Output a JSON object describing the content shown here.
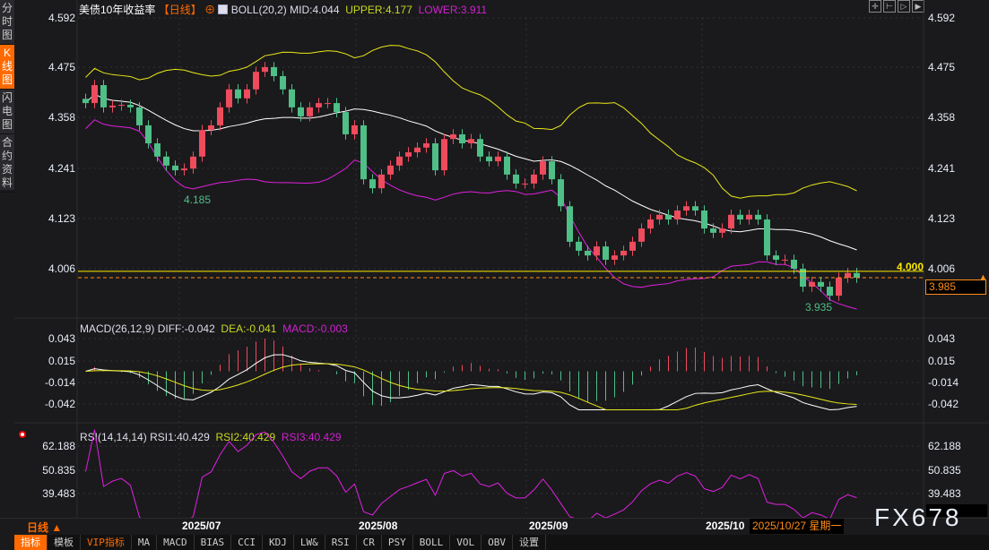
{
  "sidebar": {
    "items": [
      {
        "label": "分时图",
        "active": false
      },
      {
        "label": "K线图",
        "active": true
      },
      {
        "label": "闪电图",
        "active": false
      },
      {
        "label": "合约资料",
        "active": false
      }
    ]
  },
  "header": {
    "title": "美债10年收益率",
    "period": "【日线】",
    "boll": "BOLL(20,2)",
    "mid": "MID:4.044",
    "upper": "UPPER:4.177",
    "lower": "LOWER:3.911"
  },
  "toolbar": {
    "icons": [
      "crosshair-icon",
      "zoom-in-icon",
      "zoom-out-icon",
      "move-right-icon"
    ]
  },
  "price_axis": [
    "4.592",
    "4.475",
    "4.358",
    "4.241",
    "4.123",
    "4.006"
  ],
  "macd": {
    "label": "MACD(26,12,9)",
    "diff": "DIFF:-0.042",
    "dea": "DEA:-0.041",
    "macd": "MACD:-0.003",
    "axis": [
      "0.043",
      "0.015",
      "-0.014",
      "-0.042"
    ]
  },
  "rsi": {
    "label": "RSI(14,14,14)",
    "rsi1": "RSI1:40.429",
    "rsi2": "RSI2:40.429",
    "rsi3": "RSI3:40.429",
    "axis": [
      "62.188",
      "50.835",
      "39.483"
    ]
  },
  "annotations": {
    "high_low_low1": "4.185",
    "low2": "3.935",
    "hline": "4.000",
    "last_price": "3.985"
  },
  "dates": [
    "2025/07",
    "2025/08",
    "2025/09",
    "2025/10"
  ],
  "cursor_date": "2025/10/27 星期一",
  "period_selector": "日线 ▲",
  "watermark": "FX678",
  "tabs": [
    {
      "label": "指标",
      "active": true
    },
    {
      "label": "模板"
    },
    {
      "label": "VIP指标",
      "vip": true
    },
    {
      "label": "MA"
    },
    {
      "label": "MACD"
    },
    {
      "label": "BIAS"
    },
    {
      "label": "CCI"
    },
    {
      "label": "KDJ"
    },
    {
      "label": "LW&"
    },
    {
      "label": "RSI"
    },
    {
      "label": "CR"
    },
    {
      "label": "PSY"
    },
    {
      "label": "BOLL"
    },
    {
      "label": "VOL"
    },
    {
      "label": "OBV"
    },
    {
      "label": "设置"
    }
  ],
  "colors": {
    "up": "#ee4b5d",
    "down": "#4fbf87",
    "mid": "#ffffff",
    "upper": "#e8e81a",
    "lower": "#e020e0",
    "accent": "#ff6a00"
  },
  "chart_data": {
    "type": "candlestick",
    "ylim": [
      3.9,
      4.6
    ],
    "ticks": [
      "4.592",
      "4.475",
      "4.358",
      "4.241",
      "4.123",
      "4.006"
    ],
    "closes": [
      4.393,
      4.435,
      4.383,
      4.387,
      4.389,
      4.383,
      4.341,
      4.299,
      4.268,
      4.247,
      4.236,
      4.24,
      4.268,
      4.33,
      4.341,
      4.383,
      4.425,
      4.404,
      4.425,
      4.466,
      4.477,
      4.456,
      4.425,
      4.383,
      4.362,
      4.383,
      4.393,
      4.393,
      4.372,
      4.32,
      4.341,
      4.215,
      4.194,
      4.226,
      4.247,
      4.268,
      4.278,
      4.289,
      4.299,
      4.236,
      4.309,
      4.32,
      4.299,
      4.309,
      4.268,
      4.257,
      4.268,
      4.226,
      4.205,
      4.205,
      4.226,
      4.257,
      4.215,
      4.152,
      4.069,
      4.048,
      4.037,
      4.058,
      4.027,
      4.037,
      4.048,
      4.069,
      4.1,
      4.121,
      4.132,
      4.121,
      4.142,
      4.152,
      4.142,
      4.1,
      4.09,
      4.1,
      4.132,
      4.121,
      4.132,
      4.121,
      4.037,
      4.027,
      4.027,
      4.006,
      3.964,
      3.975,
      3.964,
      3.943,
      3.985,
      3.996,
      3.985
    ]
  }
}
